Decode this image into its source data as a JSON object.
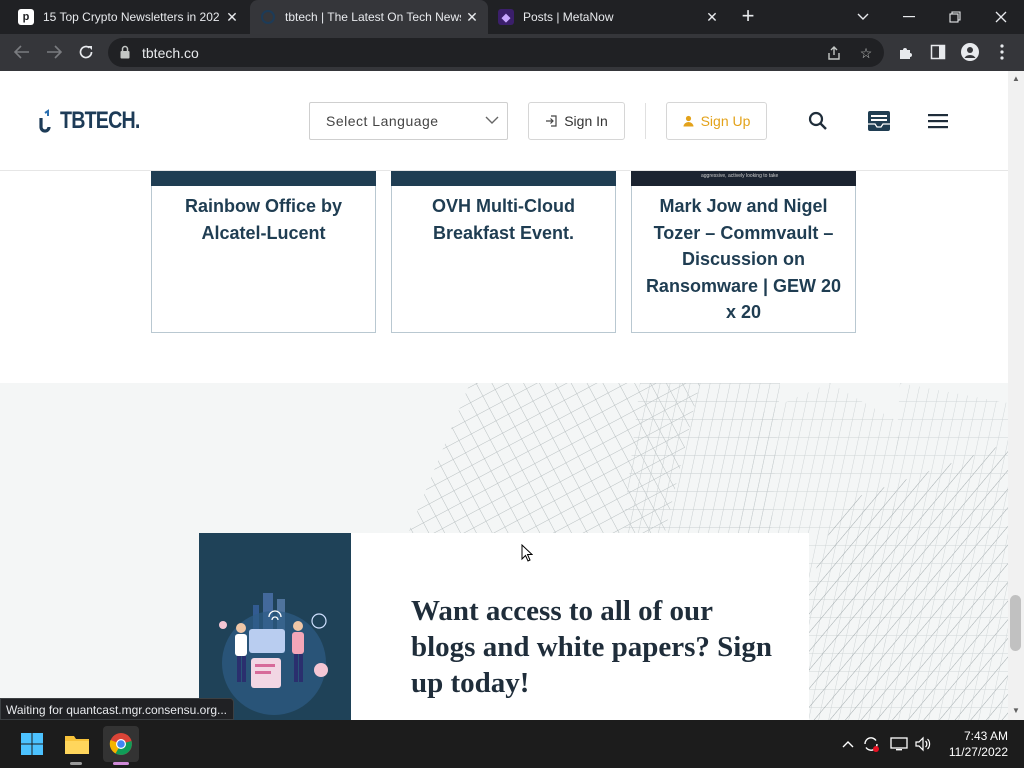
{
  "browser": {
    "tabs": [
      {
        "title": "15 Top Crypto Newsletters in 202",
        "favicon": "p-icon"
      },
      {
        "title": "tbtech | The Latest On Tech News",
        "favicon": "tbtech-icon"
      },
      {
        "title": "Posts | MetaNow",
        "favicon": "metanow-icon"
      }
    ],
    "url": "tbtech.co",
    "status": "Waiting for quantcast.mgr.consensu.org..."
  },
  "site": {
    "logo": "TBTECH.",
    "language_select": "Select Language",
    "sign_in": "Sign In",
    "sign_up": "Sign Up",
    "accent": "#e3a21a",
    "brand": "#1f3d52"
  },
  "cards": [
    {
      "title": "Rainbow Office by Alcatel-Lucent"
    },
    {
      "title": "OVH Multi-Cloud Breakfast Event."
    },
    {
      "title": "Mark Jow and Nigel Tozer – Commvault – Discussion on Ransomware | GEW 20 x 20",
      "thumb_caption": "aggressive, actively looking to take"
    }
  ],
  "promo": {
    "headline": "Want access to all of our blogs and white papers? Sign up today!"
  },
  "taskbar": {
    "time": "7:43 AM",
    "date": "11/27/2022"
  }
}
